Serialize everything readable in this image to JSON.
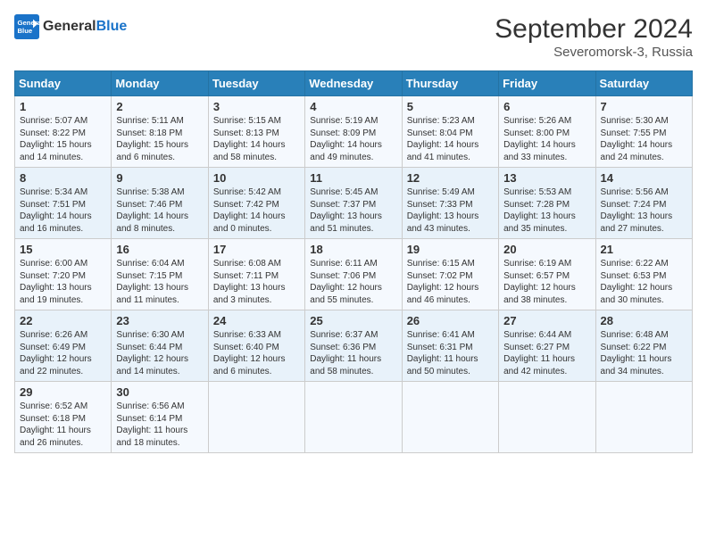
{
  "header": {
    "logo_line1": "General",
    "logo_line2": "Blue",
    "month": "September 2024",
    "location": "Severomorsk-3, Russia"
  },
  "weekdays": [
    "Sunday",
    "Monday",
    "Tuesday",
    "Wednesday",
    "Thursday",
    "Friday",
    "Saturday"
  ],
  "weeks": [
    [
      {
        "day": "1",
        "sunrise": "5:07 AM",
        "sunset": "8:22 PM",
        "daylight": "15 hours and 14 minutes."
      },
      {
        "day": "2",
        "sunrise": "5:11 AM",
        "sunset": "8:18 PM",
        "daylight": "15 hours and 6 minutes."
      },
      {
        "day": "3",
        "sunrise": "5:15 AM",
        "sunset": "8:13 PM",
        "daylight": "14 hours and 58 minutes."
      },
      {
        "day": "4",
        "sunrise": "5:19 AM",
        "sunset": "8:09 PM",
        "daylight": "14 hours and 49 minutes."
      },
      {
        "day": "5",
        "sunrise": "5:23 AM",
        "sunset": "8:04 PM",
        "daylight": "14 hours and 41 minutes."
      },
      {
        "day": "6",
        "sunrise": "5:26 AM",
        "sunset": "8:00 PM",
        "daylight": "14 hours and 33 minutes."
      },
      {
        "day": "7",
        "sunrise": "5:30 AM",
        "sunset": "7:55 PM",
        "daylight": "14 hours and 24 minutes."
      }
    ],
    [
      {
        "day": "8",
        "sunrise": "5:34 AM",
        "sunset": "7:51 PM",
        "daylight": "14 hours and 16 minutes."
      },
      {
        "day": "9",
        "sunrise": "5:38 AM",
        "sunset": "7:46 PM",
        "daylight": "14 hours and 8 minutes."
      },
      {
        "day": "10",
        "sunrise": "5:42 AM",
        "sunset": "7:42 PM",
        "daylight": "14 hours and 0 minutes."
      },
      {
        "day": "11",
        "sunrise": "5:45 AM",
        "sunset": "7:37 PM",
        "daylight": "13 hours and 51 minutes."
      },
      {
        "day": "12",
        "sunrise": "5:49 AM",
        "sunset": "7:33 PM",
        "daylight": "13 hours and 43 minutes."
      },
      {
        "day": "13",
        "sunrise": "5:53 AM",
        "sunset": "7:28 PM",
        "daylight": "13 hours and 35 minutes."
      },
      {
        "day": "14",
        "sunrise": "5:56 AM",
        "sunset": "7:24 PM",
        "daylight": "13 hours and 27 minutes."
      }
    ],
    [
      {
        "day": "15",
        "sunrise": "6:00 AM",
        "sunset": "7:20 PM",
        "daylight": "13 hours and 19 minutes."
      },
      {
        "day": "16",
        "sunrise": "6:04 AM",
        "sunset": "7:15 PM",
        "daylight": "13 hours and 11 minutes."
      },
      {
        "day": "17",
        "sunrise": "6:08 AM",
        "sunset": "7:11 PM",
        "daylight": "13 hours and 3 minutes."
      },
      {
        "day": "18",
        "sunrise": "6:11 AM",
        "sunset": "7:06 PM",
        "daylight": "12 hours and 55 minutes."
      },
      {
        "day": "19",
        "sunrise": "6:15 AM",
        "sunset": "7:02 PM",
        "daylight": "12 hours and 46 minutes."
      },
      {
        "day": "20",
        "sunrise": "6:19 AM",
        "sunset": "6:57 PM",
        "daylight": "12 hours and 38 minutes."
      },
      {
        "day": "21",
        "sunrise": "6:22 AM",
        "sunset": "6:53 PM",
        "daylight": "12 hours and 30 minutes."
      }
    ],
    [
      {
        "day": "22",
        "sunrise": "6:26 AM",
        "sunset": "6:49 PM",
        "daylight": "12 hours and 22 minutes."
      },
      {
        "day": "23",
        "sunrise": "6:30 AM",
        "sunset": "6:44 PM",
        "daylight": "12 hours and 14 minutes."
      },
      {
        "day": "24",
        "sunrise": "6:33 AM",
        "sunset": "6:40 PM",
        "daylight": "12 hours and 6 minutes."
      },
      {
        "day": "25",
        "sunrise": "6:37 AM",
        "sunset": "6:36 PM",
        "daylight": "11 hours and 58 minutes."
      },
      {
        "day": "26",
        "sunrise": "6:41 AM",
        "sunset": "6:31 PM",
        "daylight": "11 hours and 50 minutes."
      },
      {
        "day": "27",
        "sunrise": "6:44 AM",
        "sunset": "6:27 PM",
        "daylight": "11 hours and 42 minutes."
      },
      {
        "day": "28",
        "sunrise": "6:48 AM",
        "sunset": "6:22 PM",
        "daylight": "11 hours and 34 minutes."
      }
    ],
    [
      {
        "day": "29",
        "sunrise": "6:52 AM",
        "sunset": "6:18 PM",
        "daylight": "11 hours and 26 minutes."
      },
      {
        "day": "30",
        "sunrise": "6:56 AM",
        "sunset": "6:14 PM",
        "daylight": "11 hours and 18 minutes."
      },
      null,
      null,
      null,
      null,
      null
    ]
  ]
}
